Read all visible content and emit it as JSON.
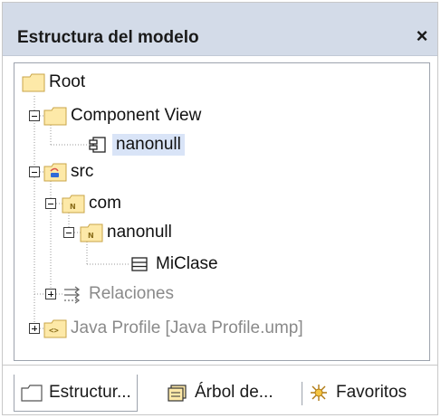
{
  "panel": {
    "title": "Estructura del modelo",
    "close_glyph": "×"
  },
  "tree": {
    "root": "Root",
    "component_view": "Component View",
    "nanonull_component": "nanonull",
    "src": "src",
    "com": "com",
    "nanonull_package": "nanonull",
    "miclase": "MiClase",
    "relaciones": "Relaciones",
    "java_profile": "Java Profile [Java Profile.ump]"
  },
  "tabs": [
    {
      "label": "Estructur...",
      "icon": "folder-icon"
    },
    {
      "label": "Árbol de...",
      "icon": "diagram-tree-icon"
    },
    {
      "label": "Favoritos",
      "icon": "favorites-icon"
    }
  ],
  "colors": {
    "titlebar_bg": "#d3dbe8",
    "folder_fill": "#fde9a8",
    "selection_bg": "#d9e4f7"
  }
}
